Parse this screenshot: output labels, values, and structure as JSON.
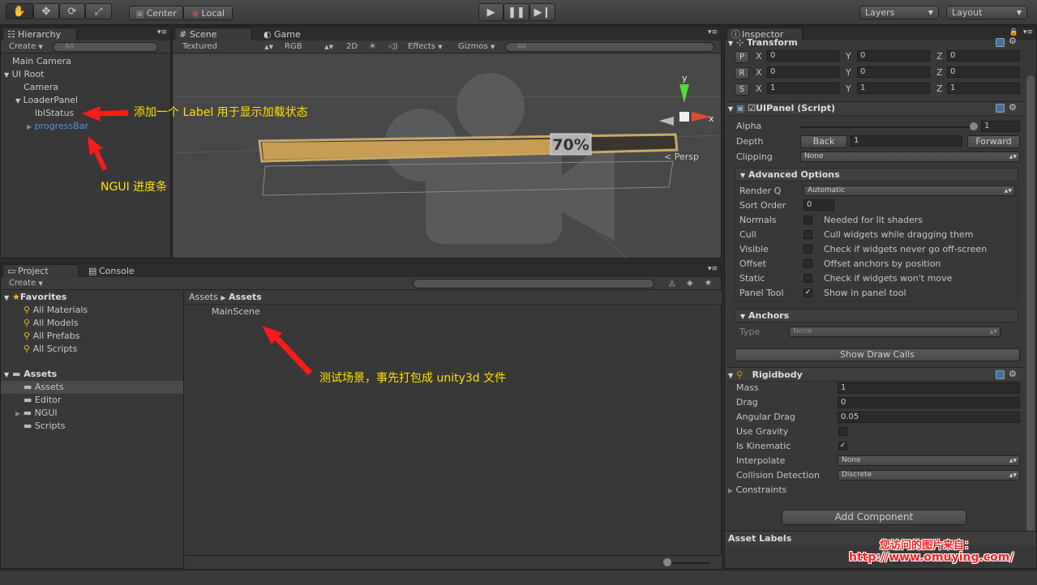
{
  "toolbar": {
    "pivot": "Center",
    "handle": "Local",
    "layers": "Layers",
    "layout": "Layout"
  },
  "hierarchy": {
    "tab": "Hierarchy",
    "create": "Create",
    "search": "All",
    "items": [
      "Main Camera",
      "UI Root",
      "Camera",
      "LoaderPanel",
      "lblStatus",
      "progressBar"
    ]
  },
  "scene": {
    "tab": "Scene",
    "game_tab": "Game",
    "render": "Textured",
    "color": "RGB",
    "mode2d": "2D",
    "effects": "Effects",
    "gizmos": "Gizmos",
    "search": "All",
    "progress": 0.7,
    "progress_label": "70%",
    "persp": "Persp",
    "axis_y": "y",
    "axis_x": "x"
  },
  "annotations": {
    "label": "添加一个 Label 用于显示加载状态",
    "ngui": "NGUI 进度条",
    "scene": "测试场景，事先打包成 unity3d 文件"
  },
  "project": {
    "tab": "Project",
    "console_tab": "Console",
    "create": "Create",
    "favorites": "Favorites",
    "fav_items": [
      "All Materials",
      "All Models",
      "All Prefabs",
      "All Scripts"
    ],
    "assets": "Assets",
    "asset_items": [
      "Assets",
      "Editor",
      "NGUI",
      "Scripts"
    ],
    "breadcrumb": [
      "Assets",
      "Assets"
    ],
    "files": [
      "MainScene"
    ]
  },
  "inspector": {
    "tab": "Inspector",
    "transform": {
      "title": "Transform",
      "p": [
        "0",
        "0",
        "0"
      ],
      "r": [
        "0",
        "0",
        "0"
      ],
      "s": [
        "1",
        "1",
        "1"
      ],
      "lp": "P",
      "lr": "R",
      "ls": "S",
      "ax": "X",
      "ay": "Y",
      "az": "Z"
    },
    "uipanel": {
      "title": "UIPanel (Script)",
      "alpha_label": "Alpha",
      "alpha": "1",
      "depth_label": "Depth",
      "depth": "1",
      "back": "Back",
      "forward": "Forward",
      "clipping_label": "Clipping",
      "clipping": "None",
      "advanced": "Advanced Options",
      "renderq_label": "Render Q",
      "renderq": "Automatic",
      "sortorder_label": "Sort Order",
      "sortorder": "0",
      "opts": [
        {
          "label": "Normals",
          "desc": "Needed for lit shaders",
          "checked": ""
        },
        {
          "label": "Cull",
          "desc": "Cull widgets while dragging them",
          "checked": ""
        },
        {
          "label": "Visible",
          "desc": "Check if widgets never go off-screen",
          "checked": ""
        },
        {
          "label": "Offset",
          "desc": "Offset anchors by position",
          "checked": ""
        },
        {
          "label": "Static",
          "desc": "Check if widgets won't move",
          "checked": ""
        },
        {
          "label": "Panel Tool",
          "desc": "Show in panel tool",
          "checked": "✓"
        }
      ],
      "anchors": "Anchors",
      "type_label": "Type",
      "type": "None",
      "drawcalls": "Show Draw Calls"
    },
    "rigidbody": {
      "title": "Rigidbody",
      "rows": [
        {
          "label": "Mass",
          "value": "1"
        },
        {
          "label": "Drag",
          "value": "0"
        },
        {
          "label": "Angular Drag",
          "value": "0.05"
        }
      ],
      "gravity_label": "Use Gravity",
      "gravity": "",
      "kinematic_label": "Is Kinematic",
      "kinematic": "✓",
      "interp_label": "Interpolate",
      "interp": "None",
      "coll_label": "Collision Detection",
      "coll": "Discrete",
      "constraints": "Constraints"
    },
    "add_component": "Add Component",
    "asset_labels": "Asset Labels"
  },
  "watermark": {
    "line1": "您访问的图片来自：",
    "line2": "http://www.omuying.com/"
  }
}
